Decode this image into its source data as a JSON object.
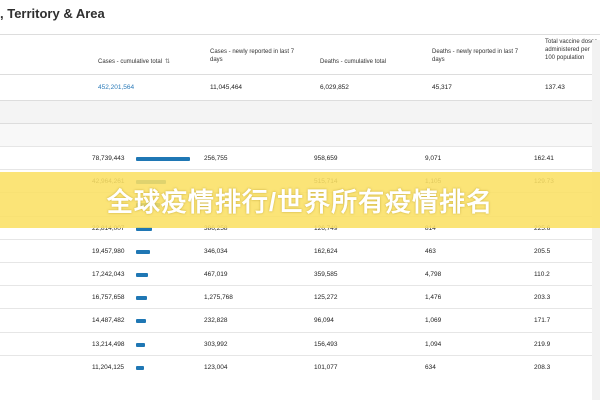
{
  "heading": ", Territory & Area",
  "columns": [
    {
      "label": "Cases - cumulative total",
      "sortable": true
    },
    {
      "label": "Cases - newly reported in last 7 days"
    },
    {
      "label": "Deaths - cumulative total"
    },
    {
      "label": "Deaths - newly reported in last 7 days"
    },
    {
      "label": "Total vaccine doses administered per 100 population"
    }
  ],
  "global_row": [
    "452,201,564",
    "11,045,464",
    "6,029,852",
    "45,317",
    "137.43"
  ],
  "rows": [
    {
      "cases": "78,739,443",
      "bar": 1.0,
      "new_cases": "256,755",
      "deaths": "958,659",
      "new_deaths": "9,071",
      "vacc": "162.41"
    },
    {
      "cases": "42,964,261",
      "bar": 0.55,
      "new_cases": "",
      "deaths": "515,714",
      "new_deaths": "1,105",
      "vacc": "129.73"
    },
    {
      "cases": "",
      "bar": 0.45,
      "new_cases": "",
      "deaths": "",
      "new_deaths": "",
      "vacc": ""
    },
    {
      "cases": "22,814,007",
      "bar": 0.29,
      "new_cases": "386,258",
      "deaths": "126,749",
      "new_deaths": "814",
      "vacc": "225.6"
    },
    {
      "cases": "19,457,980",
      "bar": 0.25,
      "new_cases": "346,034",
      "deaths": "162,624",
      "new_deaths": "463",
      "vacc": "205.5"
    },
    {
      "cases": "17,242,043",
      "bar": 0.22,
      "new_cases": "467,019",
      "deaths": "359,585",
      "new_deaths": "4,798",
      "vacc": "110.2"
    },
    {
      "cases": "16,757,658",
      "bar": 0.21,
      "new_cases": "1,275,768",
      "deaths": "125,272",
      "new_deaths": "1,476",
      "vacc": "203.3"
    },
    {
      "cases": "14,487,482",
      "bar": 0.18,
      "new_cases": "232,828",
      "deaths": "96,094",
      "new_deaths": "1,069",
      "vacc": "171.7"
    },
    {
      "cases": "13,214,498",
      "bar": 0.17,
      "new_cases": "303,992",
      "deaths": "156,493",
      "new_deaths": "1,094",
      "vacc": "219.9"
    },
    {
      "cases": "11,204,125",
      "bar": 0.14,
      "new_cases": "123,004",
      "deaths": "101,077",
      "new_deaths": "634",
      "vacc": "208.3"
    }
  ],
  "banner_text": "全球疫情排行/世界所有疫情排名",
  "colors": {
    "bar": "#1f77b4",
    "link": "#2b7bb9",
    "banner": "#fae064"
  }
}
